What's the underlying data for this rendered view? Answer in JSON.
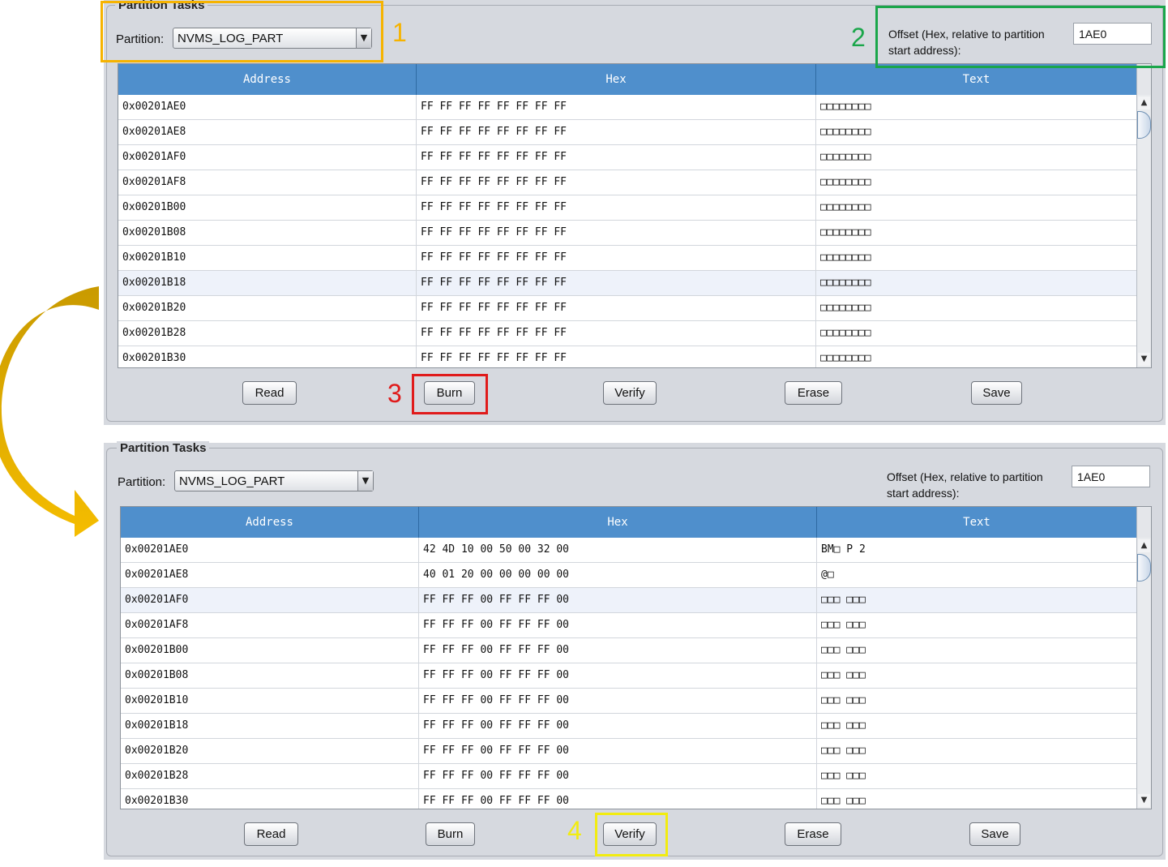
{
  "colors": {
    "header_blue": "#4f8fcc",
    "panel_gray": "#d6d9df",
    "annotation_orange": "#f6b300",
    "annotation_green": "#1aa64a",
    "annotation_red": "#e01b1b",
    "annotation_yellow": "#f2ec10",
    "arrow_gold": "#e2a800"
  },
  "top_panel": {
    "title": "Partition Tasks",
    "partition_label": "Partition:",
    "partition_value": "NVMS_LOG_PART",
    "offset_label": "Offset (Hex, relative to partition start address):",
    "offset_value": "1AE0",
    "columns": [
      "Address",
      "Hex",
      "Text"
    ],
    "highlighted_row_index": 7,
    "rows": [
      {
        "address": "0x00201AE0",
        "hex": "FF FF FF FF FF FF FF FF",
        "text": "□□□□□□□□"
      },
      {
        "address": "0x00201AE8",
        "hex": "FF FF FF FF FF FF FF FF",
        "text": "□□□□□□□□"
      },
      {
        "address": "0x00201AF0",
        "hex": "FF FF FF FF FF FF FF FF",
        "text": "□□□□□□□□"
      },
      {
        "address": "0x00201AF8",
        "hex": "FF FF FF FF FF FF FF FF",
        "text": "□□□□□□□□"
      },
      {
        "address": "0x00201B00",
        "hex": "FF FF FF FF FF FF FF FF",
        "text": "□□□□□□□□"
      },
      {
        "address": "0x00201B08",
        "hex": "FF FF FF FF FF FF FF FF",
        "text": "□□□□□□□□"
      },
      {
        "address": "0x00201B10",
        "hex": "FF FF FF FF FF FF FF FF",
        "text": "□□□□□□□□"
      },
      {
        "address": "0x00201B18",
        "hex": "FF FF FF FF FF FF FF FF",
        "text": "□□□□□□□□"
      },
      {
        "address": "0x00201B20",
        "hex": "FF FF FF FF FF FF FF FF",
        "text": "□□□□□□□□"
      },
      {
        "address": "0x00201B28",
        "hex": "FF FF FF FF FF FF FF FF",
        "text": "□□□□□□□□"
      },
      {
        "address": "0x00201B30",
        "hex": "FF FF FF FF FF FF FF FF",
        "text": "□□□□□□□□"
      }
    ],
    "buttons": {
      "read": "Read",
      "burn": "Burn",
      "verify": "Verify",
      "erase": "Erase",
      "save": "Save"
    }
  },
  "bottom_panel": {
    "title": "Partition Tasks",
    "partition_label": "Partition:",
    "partition_value": "NVMS_LOG_PART",
    "offset_label": "Offset (Hex, relative to partition start address):",
    "offset_value": "1AE0",
    "columns": [
      "Address",
      "Hex",
      "Text"
    ],
    "highlighted_row_index": 2,
    "rows": [
      {
        "address": "0x00201AE0",
        "hex": "42 4D 10 00 50 00 32 00",
        "text": "BM□ P 2"
      },
      {
        "address": "0x00201AE8",
        "hex": "40 01 20 00 00 00 00 00",
        "text": "@□"
      },
      {
        "address": "0x00201AF0",
        "hex": "FF FF FF 00 FF FF FF 00",
        "text": "□□□ □□□"
      },
      {
        "address": "0x00201AF8",
        "hex": "FF FF FF 00 FF FF FF 00",
        "text": "□□□ □□□"
      },
      {
        "address": "0x00201B00",
        "hex": "FF FF FF 00 FF FF FF 00",
        "text": "□□□ □□□"
      },
      {
        "address": "0x00201B08",
        "hex": "FF FF FF 00 FF FF FF 00",
        "text": "□□□ □□□"
      },
      {
        "address": "0x00201B10",
        "hex": "FF FF FF 00 FF FF FF 00",
        "text": "□□□ □□□"
      },
      {
        "address": "0x00201B18",
        "hex": "FF FF FF 00 FF FF FF 00",
        "text": "□□□ □□□"
      },
      {
        "address": "0x00201B20",
        "hex": "FF FF FF 00 FF FF FF 00",
        "text": "□□□ □□□"
      },
      {
        "address": "0x00201B28",
        "hex": "FF FF FF 00 FF FF FF 00",
        "text": "□□□ □□□"
      },
      {
        "address": "0x00201B30",
        "hex": "FF FF FF 00 FF FF FF 00",
        "text": "□□□ □□□"
      }
    ],
    "buttons": {
      "read": "Read",
      "burn": "Burn",
      "verify": "Verify",
      "erase": "Erase",
      "save": "Save"
    }
  },
  "annotations": {
    "step1": "1",
    "step2": "2",
    "step3": "3",
    "step4": "4"
  },
  "icons": {
    "dropdown": "chevron-down-icon",
    "scroll_up": "arrow-up-icon",
    "scroll_down": "arrow-down-icon",
    "flow_arrow": "curved-arrow-icon"
  }
}
